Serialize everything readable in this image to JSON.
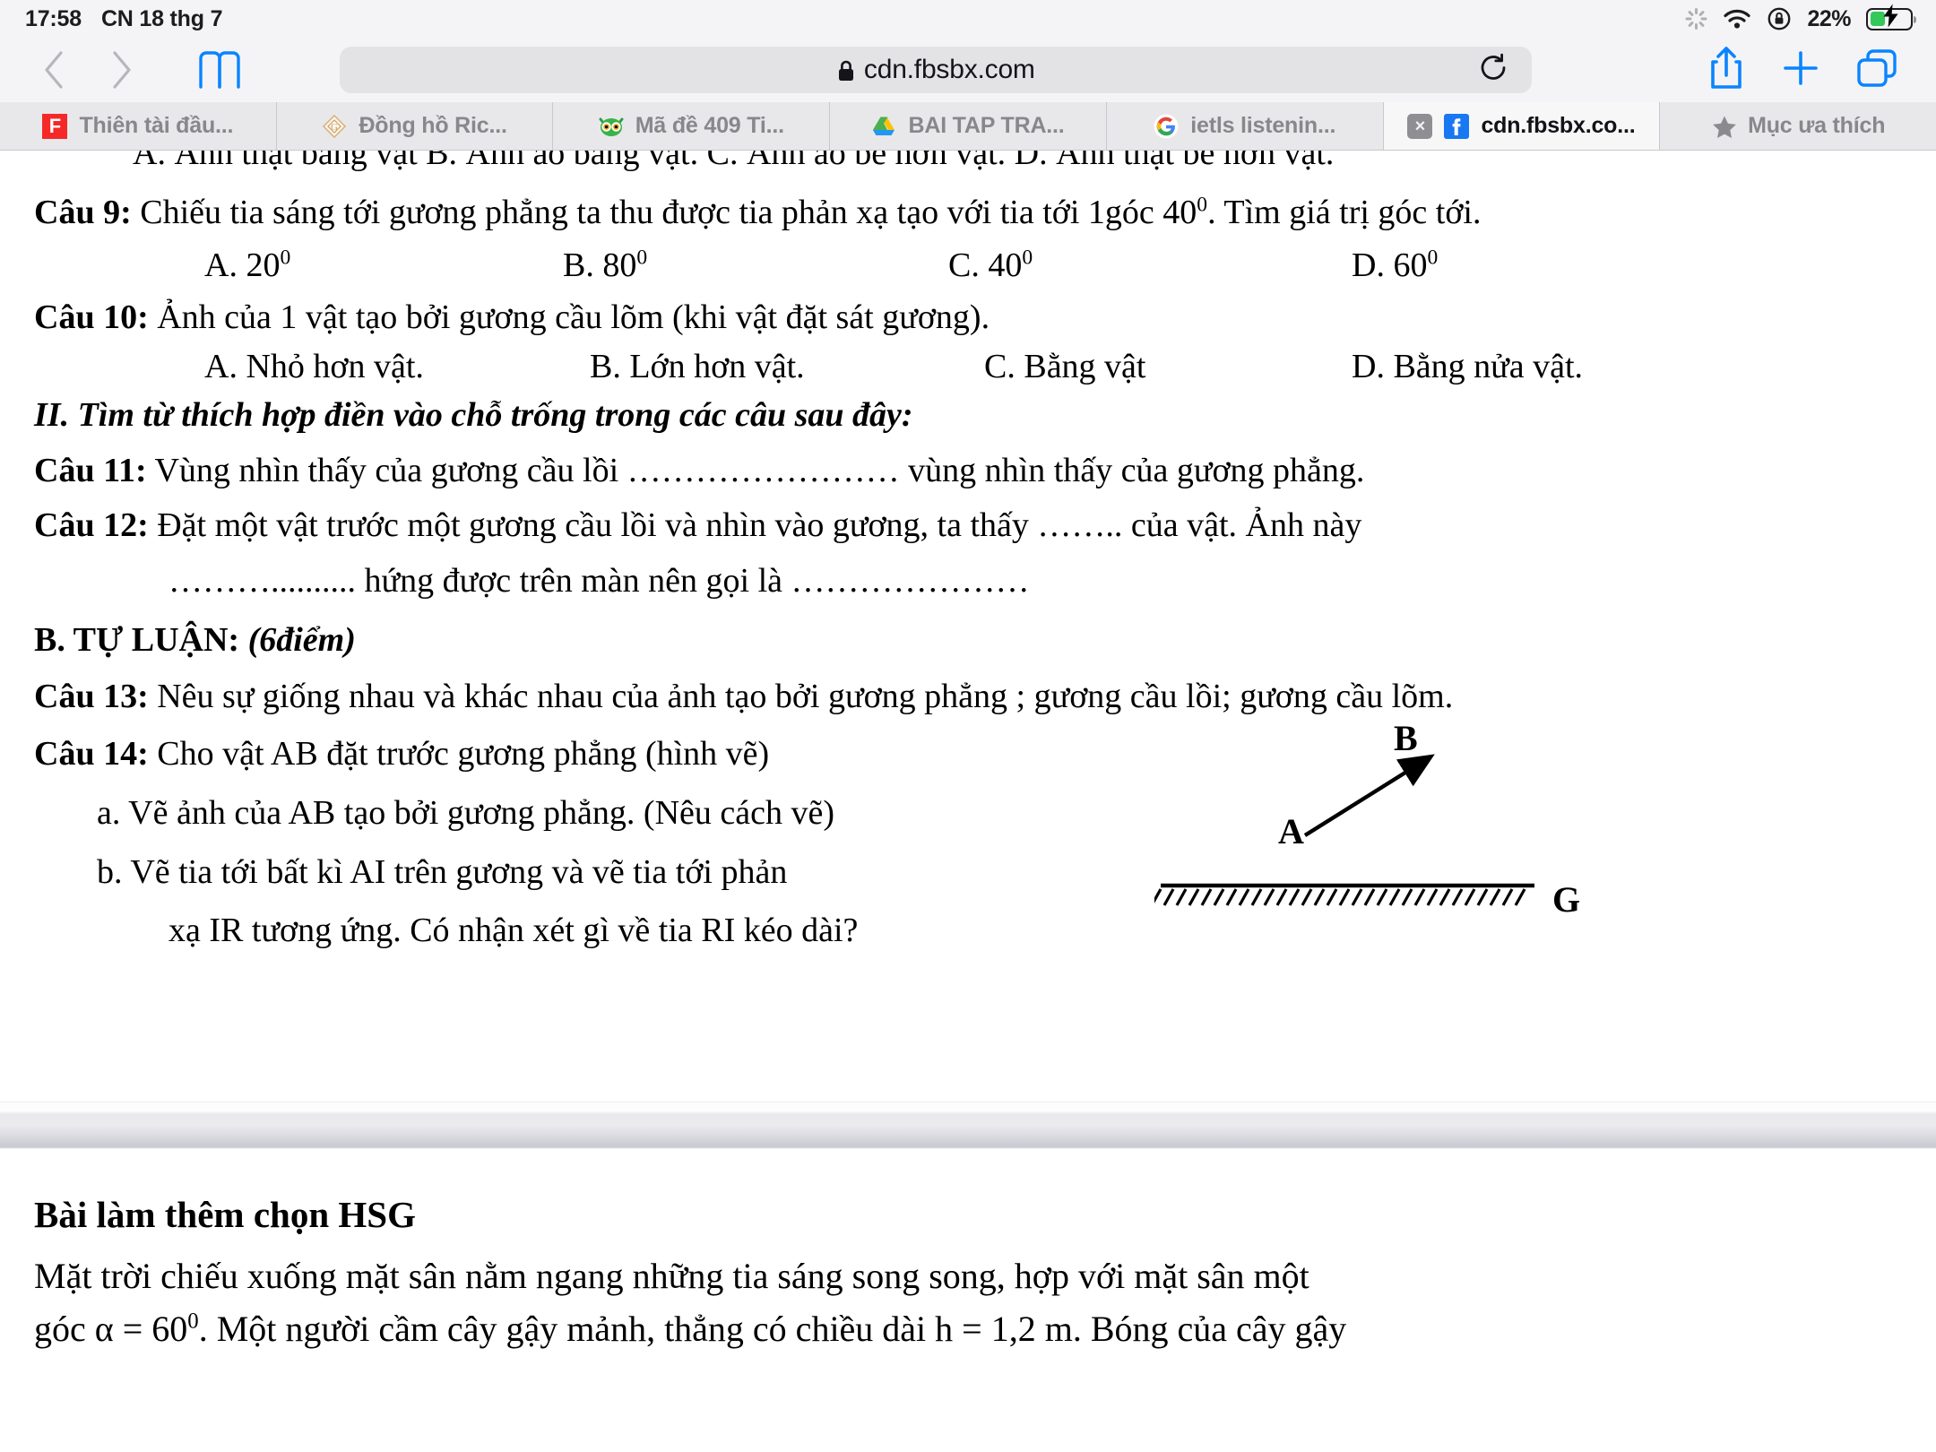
{
  "status_bar": {
    "time": "17:58",
    "date": "CN 18 thg 7",
    "battery_percent": "22%",
    "icons": [
      "activity-spinner-icon",
      "wifi-icon",
      "rotation-lock-icon",
      "battery-charging-icon"
    ]
  },
  "toolbar": {
    "back_icon": "chevron-left-icon",
    "forward_icon": "chevron-right-icon",
    "bookmarks_icon": "book-icon",
    "url": "cdn.fbsbx.com",
    "lock_icon": "lock-icon",
    "reload_icon": "reload-icon",
    "share_icon": "share-icon",
    "new_tab_icon": "plus-icon",
    "tabs_icon": "tabs-overview-icon",
    "accent_color": "#0a84ff"
  },
  "tabs": [
    {
      "label": "Thiên tài đầu...",
      "icon": "flipboard-icon",
      "active": false
    },
    {
      "label": "Đồng hồ Ric...",
      "icon": "diamond-watch-icon",
      "active": false
    },
    {
      "label": "Mã đề 409 Ti...",
      "icon": "owl-icon",
      "active": false
    },
    {
      "label": "BAI TAP TRA...",
      "icon": "google-drive-icon",
      "active": false
    },
    {
      "label": "ietls listenin...",
      "icon": "google-icon",
      "active": false
    },
    {
      "label": "cdn.fbsbx.co...",
      "icon": "facebook-icon",
      "active": true,
      "close_label": "×"
    },
    {
      "label": "Mục ưa thích",
      "icon": "star-icon",
      "active": false
    }
  ],
  "document": {
    "page1": {
      "cut_line": "A. Ảnh thật bằng vật     B. Ảnh ảo bằng vật.     C. Ảnh ảo bé hơn vật.  D. Ảnh thật bé hơn vật.",
      "q9": {
        "num": "Câu 9:",
        "text": " Chiếu tia sáng tới gương phẳng ta thu được tia phản xạ tạo với tia tới 1góc 40",
        "sup": "0",
        "tail": ". Tìm giá trị góc tới.",
        "options": [
          {
            "letter": "A. 20",
            "sup": "0"
          },
          {
            "letter": "B. 80",
            "sup": "0"
          },
          {
            "letter": "C. 40",
            "sup": "0"
          },
          {
            "letter": "D. 60",
            "sup": "0"
          }
        ]
      },
      "q10": {
        "num": "Câu 10:",
        "text": " Ảnh của 1 vật tạo bởi gương cầu lõm (khi vật đặt sát gương).",
        "options": [
          "A. Nhỏ hơn vật.",
          "B. Lớn hơn vật.",
          "C. Bằng vật",
          "D. Bằng nửa vật."
        ]
      },
      "section2": "II. Tìm từ thích hợp điền vào chỗ trống trong các câu sau đây:",
      "q11": {
        "num": "Câu 11:",
        "text": " Vùng nhìn thấy của gương cầu lồi …………………… vùng nhìn thấy của gương phẳng."
      },
      "q12": {
        "num": "Câu 12:",
        "text": " Đặt một vật trước một gương cầu lồi và nhìn vào gương, ta thấy …….. của vật. Ảnh này",
        "line2": "……….......... hứng được trên màn nên gọi là …………………"
      },
      "sectionB": {
        "bold": "B. TỰ LUẬN:",
        "italic": " (6điểm)"
      },
      "q13": {
        "num": "Câu 13:",
        "text": "  Nêu sự giống nhau và khác nhau của ảnh tạo bởi gương phẳng ; gương cầu lồi; gương cầu lõm."
      },
      "q14": {
        "num": "Câu 14:",
        "text": "  Cho vật  AB  đặt  trước gương  phẳng  (hình vẽ)",
        "a": "a. Vẽ ảnh của AB tạo bởi gương phẳng. (Nêu cách vẽ)",
        "b": "b. Vẽ tia tới bất kì  AI  trên gương và vẽ tia  tới  phản",
        "b2": "xạ IR  tương ứng. Có nhận xét gì về tia RI  kéo dài?"
      },
      "diagram": {
        "label_a": "A",
        "label_b": "B",
        "label_g": "G",
        "description": "vector-ab-above-plane-mirror"
      }
    },
    "page2": {
      "heading": "Bài làm thêm chọn HSG",
      "line1": " Mặt trời chiếu xuống mặt sân nằm ngang những tia sáng song song, hợp với mặt sân một",
      "line2_a": "góc α = 60",
      "line2_sup": "0",
      "line2_b": ". Một người cầm cây gậy mảnh, thẳng có chiều dài h = 1,2 m. Bóng của cây gậy"
    }
  }
}
